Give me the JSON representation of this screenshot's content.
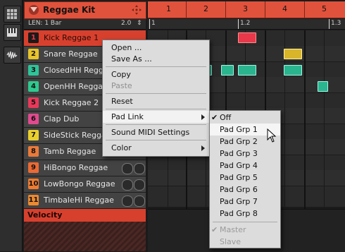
{
  "kit": {
    "title": "Reggae Kit"
  },
  "len_row": {
    "len_label": "LEN: 1 Bar",
    "len_value": "2.0"
  },
  "ruler": {
    "bars": [
      "1",
      "2",
      "3",
      "4",
      "5"
    ],
    "sub_labels": [
      "1",
      "1.2",
      "1.3"
    ]
  },
  "sounds": [
    {
      "num": "1",
      "name": "Kick Reggae 1",
      "color": "#e8384a",
      "selected": true
    },
    {
      "num": "2",
      "name": "Snare Reggae",
      "color": "#e7c42a"
    },
    {
      "num": "3",
      "name": "ClosedHH Reggae",
      "color": "#2ec49a"
    },
    {
      "num": "4",
      "name": "OpenHH Reggae",
      "color": "#2fc98f"
    },
    {
      "num": "5",
      "name": "Kick Reggae 2",
      "color": "#e8385a"
    },
    {
      "num": "6",
      "name": "Clap Dub",
      "color": "#e04a8e"
    },
    {
      "num": "7",
      "name": "SideStick Reggae",
      "color": "#e9d02d"
    },
    {
      "num": "8",
      "name": "Tamb Reggae",
      "color": "#ea7a3a"
    },
    {
      "num": "9",
      "name": "HiBongo Reggae",
      "color": "#eb6a34"
    },
    {
      "num": "10",
      "name": "LowBongo Reggae",
      "color": "#ee7b30"
    },
    {
      "num": "11",
      "name": "TimbaleHi Reggae",
      "color": "#ed8a2f"
    }
  ],
  "velocity": {
    "label": "Velocity"
  },
  "context_menu": {
    "items": [
      {
        "label": "Open ..."
      },
      {
        "label": "Save As ..."
      },
      {
        "label": "Copy"
      },
      {
        "label": "Paste",
        "disabled": true
      },
      {
        "label": "Reset"
      },
      {
        "label": "Pad Link",
        "submenu": true,
        "highlighted": true
      },
      {
        "label": "Sound MIDI Settings"
      },
      {
        "label": "Color",
        "submenu": true
      }
    ]
  },
  "pad_link_submenu": {
    "items": [
      {
        "label": "Off",
        "checked": true
      },
      {
        "label": "Pad Grp 1",
        "highlighted": true
      },
      {
        "label": "Pad Grp 2"
      },
      {
        "label": "Pad Grp 3"
      },
      {
        "label": "Pad Grp 4"
      },
      {
        "label": "Pad Grp 5"
      },
      {
        "label": "Pad Grp 6"
      },
      {
        "label": "Pad Grp 7"
      },
      {
        "label": "Pad Grp 8"
      },
      {
        "label": "Master",
        "checked": true,
        "disabled": true
      },
      {
        "label": "Slave",
        "disabled": true
      }
    ]
  },
  "colors": {
    "accent": "#e0523c",
    "note_fill": "#2bb58f",
    "note_selected": "#e8384a",
    "note_snare": "#d9b52a"
  }
}
